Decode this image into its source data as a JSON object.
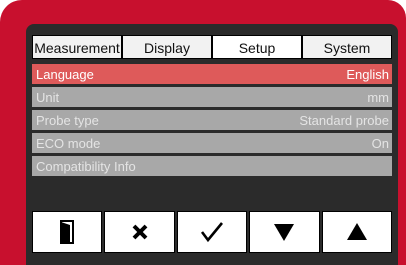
{
  "tabs": [
    {
      "label": "Measurement",
      "active": false
    },
    {
      "label": "Display",
      "active": false
    },
    {
      "label": "Setup",
      "active": true
    },
    {
      "label": "System",
      "active": false
    }
  ],
  "rows": [
    {
      "label": "Language",
      "value": "English",
      "selected": true
    },
    {
      "label": "Unit",
      "value": "mm",
      "selected": false
    },
    {
      "label": "Probe type",
      "value": "Standard probe",
      "selected": false
    },
    {
      "label": "ECO mode",
      "value": "On",
      "selected": false
    },
    {
      "label": "Compatibility Info",
      "value": "",
      "selected": false
    }
  ],
  "buttons": [
    {
      "icon": "exit-door-icon"
    },
    {
      "icon": "cancel-x-icon"
    },
    {
      "icon": "confirm-check-icon"
    },
    {
      "icon": "arrow-down-icon"
    },
    {
      "icon": "arrow-up-icon"
    }
  ],
  "colors": {
    "device_red": "#c8102e",
    "selected_row": "#de5a5a",
    "row_gray": "#a8a8a8",
    "screen_dark": "#2b2b2b"
  }
}
